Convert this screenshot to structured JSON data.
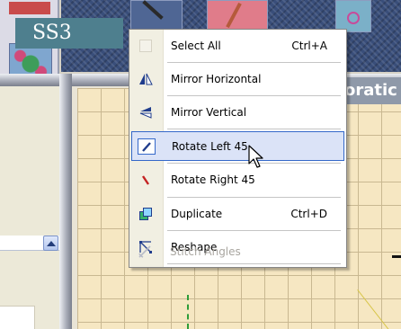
{
  "overlay": {
    "label": "SS3"
  },
  "header": {
    "title_fragment": "oratic"
  },
  "context_menu": {
    "items": [
      {
        "label": "Select All",
        "shortcut": "Ctrl+A",
        "icon": "select-all-icon",
        "state": "normal"
      },
      {
        "label": "Mirror Horizontal",
        "shortcut": "",
        "icon": "mirror-horizontal-icon",
        "state": "normal"
      },
      {
        "label": "Mirror Vertical",
        "shortcut": "",
        "icon": "mirror-vertical-icon",
        "state": "normal"
      },
      {
        "label": "Rotate Left 45",
        "shortcut": "",
        "icon": "rotate-left-icon",
        "state": "highlighted"
      },
      {
        "label": "Rotate Right 45",
        "shortcut": "",
        "icon": "rotate-right-icon",
        "state": "normal"
      },
      {
        "label": "Duplicate",
        "shortcut": "Ctrl+D",
        "icon": "duplicate-icon",
        "state": "normal"
      },
      {
        "label": "Reshape",
        "shortcut": "",
        "icon": "reshape-icon",
        "state": "normal"
      },
      {
        "label": "Stitch Angles",
        "shortcut": "",
        "icon": "stitch-angles-icon",
        "state": "disabled"
      }
    ]
  },
  "colors": {
    "highlight_fill": "#dbe3f7",
    "highlight_border": "#3468c9",
    "menu_gutter": "#f1efe2",
    "badge": "#4e7f8e",
    "disabled_text": "#a9a6a0"
  }
}
